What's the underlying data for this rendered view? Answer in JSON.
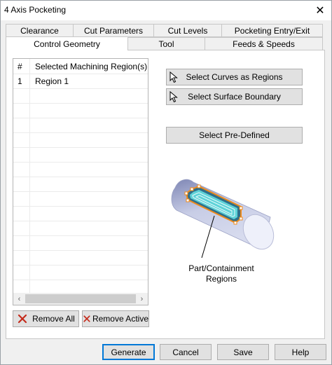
{
  "window": {
    "title": "4 Axis Pocketing",
    "close_glyph": "✕"
  },
  "tabs_row1": [
    {
      "label": "Clearance"
    },
    {
      "label": "Cut Parameters"
    },
    {
      "label": "Cut Levels"
    },
    {
      "label": "Pocketing Entry/Exit"
    }
  ],
  "tabs_row2": [
    {
      "label": "Control Geometry",
      "active": true
    },
    {
      "label": "Tool"
    },
    {
      "label": "Feeds & Speeds"
    }
  ],
  "region_list": {
    "headers": {
      "num": "#",
      "name": "Selected Machining Region(s)"
    },
    "rows": [
      {
        "num": "1",
        "name": "Region 1"
      }
    ]
  },
  "scroll": {
    "left_glyph": "‹",
    "right_glyph": "›"
  },
  "buttons": {
    "select_curves": "Select Curves as Regions",
    "select_surface": "Select Surface Boundary",
    "select_predefined": "Select Pre-Defined",
    "remove_all": "Remove All",
    "remove_active": "Remove Active"
  },
  "illustration": {
    "caption_line1": "Part/Containment",
    "caption_line2": "Regions"
  },
  "footer": {
    "generate": "Generate",
    "cancel": "Cancel",
    "save": "Save",
    "help": "Help"
  },
  "colors": {
    "accent": "#0078d7",
    "remove_icon": "#c42b1c",
    "region_fill": "#5fd3d8",
    "boundary": "#f08a1a",
    "cylinder": "#c8cde6"
  }
}
